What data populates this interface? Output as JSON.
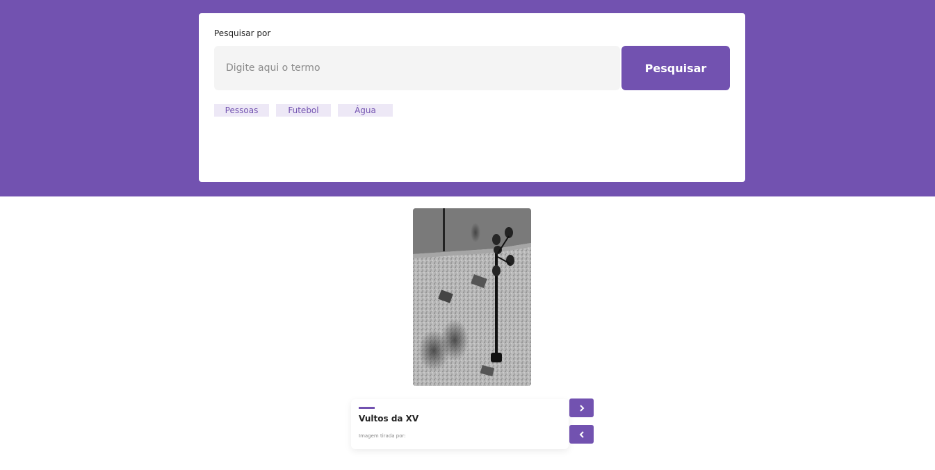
{
  "search": {
    "label": "Pesquisar por",
    "placeholder": "Digite aqui o termo",
    "value": "",
    "button_label": "Pesquisar"
  },
  "tags": [
    "Pessoas",
    "Futebol",
    "Água"
  ],
  "gallery": {
    "photo_icon": "street-lamp-photo",
    "title": "Vultos da XV",
    "credit": "Imagem tirada por:",
    "next_icon": "chevron-right-icon",
    "prev_icon": "chevron-left-icon"
  },
  "colors": {
    "brand": "#7252b0",
    "tag_bg": "#ede8f6",
    "input_bg": "#f4f4f4"
  }
}
